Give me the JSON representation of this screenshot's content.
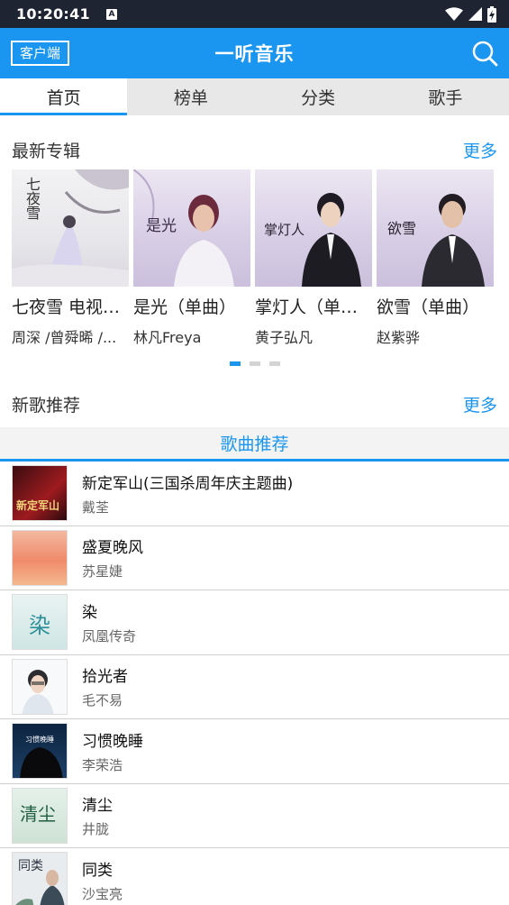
{
  "status_bar": {
    "time": "10:20:41",
    "notification_icon": "A"
  },
  "app_bar": {
    "client_label": "客户端",
    "title": "一听音乐",
    "search_icon": "search-icon"
  },
  "tabs": [
    {
      "label": "首页",
      "active": true
    },
    {
      "label": "榜单",
      "active": false
    },
    {
      "label": "分类",
      "active": false
    },
    {
      "label": "歌手",
      "active": false
    }
  ],
  "latest_albums": {
    "title": "最新专辑",
    "more": "更多",
    "items": [
      {
        "name": "七夜雪 电视剧原声带",
        "artist": "周深 /曾舜晞 /...",
        "cover_text": "七夜雪"
      },
      {
        "name": "是光（单曲）",
        "artist": "林凡Freya",
        "cover_text": "是光"
      },
      {
        "name": "掌灯人（单曲）",
        "artist": "黄子弘凡",
        "cover_text": "掌灯人"
      },
      {
        "name": "欲雪（单曲）",
        "artist": "赵紫骅",
        "cover_text": "欲雪"
      }
    ],
    "pager": {
      "count": 3,
      "active": 1
    }
  },
  "new_songs": {
    "title": "新歌推荐",
    "more": "更多",
    "tab_label": "歌曲推荐",
    "items": [
      {
        "title": "新定军山(三国杀周年庆主题曲)",
        "artist": "戴荃",
        "thumb_text": "新定军山"
      },
      {
        "title": "盛夏晚风",
        "artist": "苏星婕",
        "thumb_text": ""
      },
      {
        "title": "染",
        "artist": "凤凰传奇",
        "thumb_text": "染"
      },
      {
        "title": "拾光者",
        "artist": "毛不易",
        "thumb_text": ""
      },
      {
        "title": "习惯晚睡",
        "artist": "李荣浩",
        "thumb_text": "习惯晚睡"
      },
      {
        "title": "清尘",
        "artist": "井胧",
        "thumb_text": "清尘"
      },
      {
        "title": "同类",
        "artist": "沙宝亮",
        "thumb_text": "同类"
      }
    ]
  },
  "colors": {
    "accent": "#1a96f0",
    "status_bar": "#1f2433",
    "tab_bg": "#e8e8e8"
  }
}
